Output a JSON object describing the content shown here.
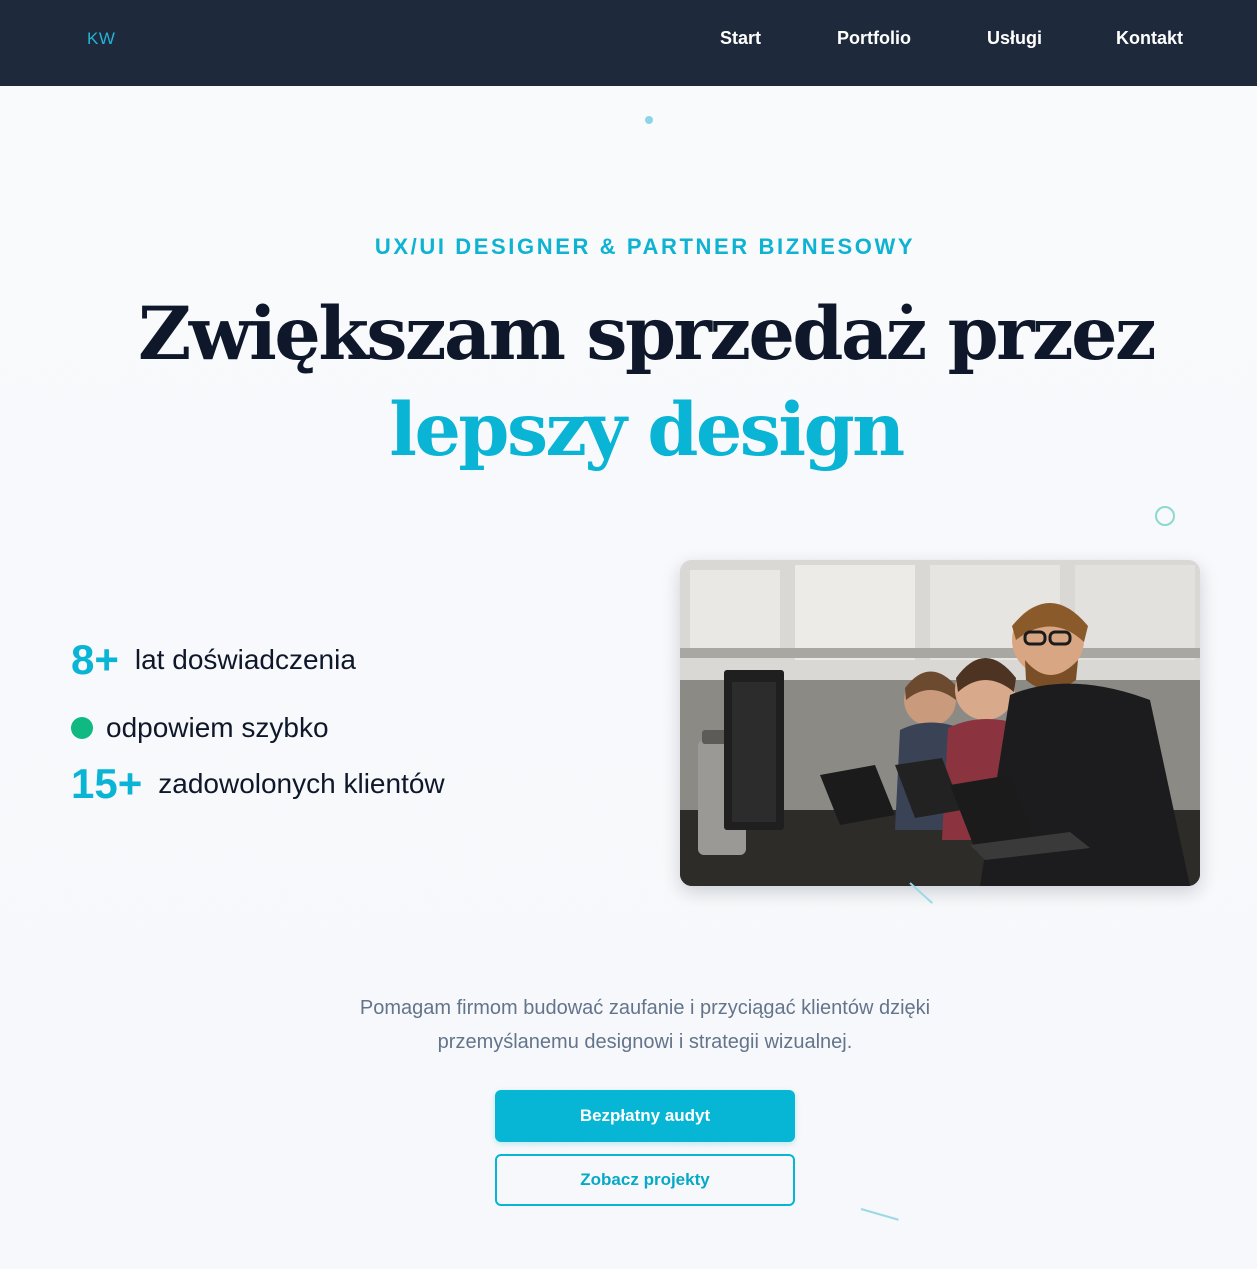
{
  "header": {
    "logo": "KW",
    "nav": {
      "start": "Start",
      "portfolio": "Portfolio",
      "uslugi": "Usługi",
      "kontakt": "Kontakt"
    }
  },
  "hero": {
    "eyebrow": "UX/UI DESIGNER & PARTNER BIZNESOWY",
    "headline_line1": "Zwiększam sprzedaż przez",
    "headline_line2": "lepszy design"
  },
  "stats": [
    {
      "number": "8+",
      "label": "lat doświadczenia"
    },
    {
      "indicator": "green-status-dot",
      "label": "odpowiem szybko"
    },
    {
      "number": "15+",
      "label": "zadowolonych klientów"
    }
  ],
  "photo": {
    "subject": "people working on laptops in an office"
  },
  "description": {
    "line1": "Pomagam firmom budować zaufanie i przyciągać klientów dzięki",
    "line2": "przemyślanemu designowi i strategii wizualnej."
  },
  "buttons": {
    "primary": "Bezpłatny audyt",
    "secondary": "Zobacz projekty"
  },
  "colors": {
    "header_bg": "#1e293b",
    "accent": "#06b6d4",
    "headline": "#0f172a",
    "status_green": "#10b981",
    "muted_text": "#64748b"
  }
}
